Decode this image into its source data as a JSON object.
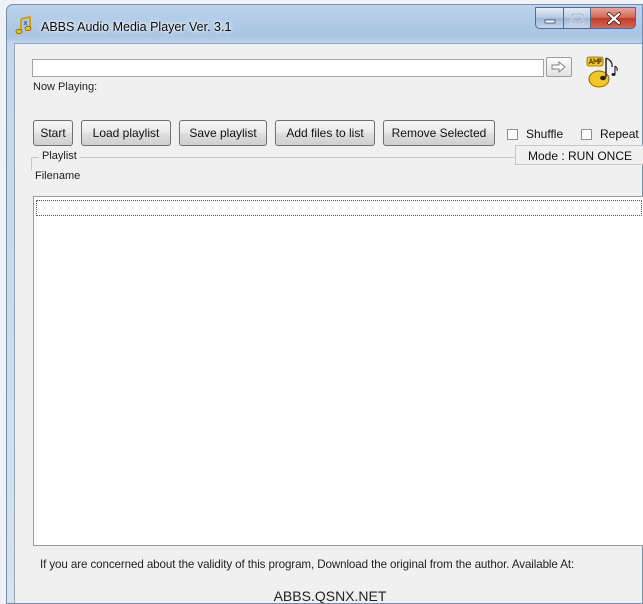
{
  "window": {
    "title": "ABBS Audio Media Player Ver. 3.1",
    "icon": "music-note-icon",
    "caption_buttons": [
      "minimize",
      "maximize",
      "close"
    ]
  },
  "now_playing": {
    "label": "Now Playing:",
    "value": ""
  },
  "toolbar": {
    "start_label": "Start",
    "load_playlist_label": "Load playlist",
    "save_playlist_label": "Save playlist",
    "add_files_label": "Add files to list",
    "remove_selected_label": "Remove Selected",
    "shuffle_label": "Shuffle",
    "repeat_label": "Repeat",
    "shuffle_checked": false,
    "repeat_checked": false
  },
  "playlist": {
    "group_title": "Playlist",
    "mode_text": "Mode : RUN ONCE",
    "column_header": "Filename",
    "rows": []
  },
  "footer": {
    "note": "If you are concerned about the validity of this program, Download the original from the author.  Available At:",
    "url": "ABBS.QSNX.NET"
  },
  "colors": {
    "window_frame": "#a9c4e2",
    "client_bg": "#f0f0f0",
    "close_button": "#c0392a",
    "logo_yellow": "#f3c623"
  }
}
